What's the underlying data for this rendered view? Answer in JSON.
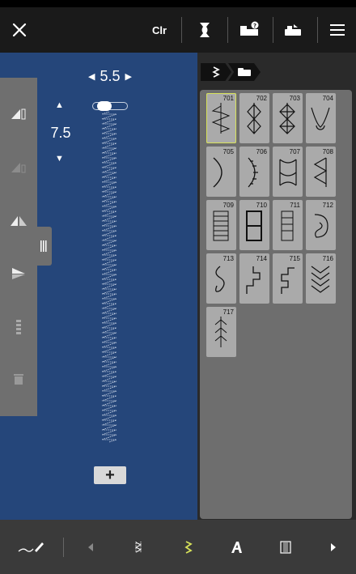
{
  "topbar": {
    "close_icon": "close-icon",
    "clear_label": "Clr",
    "icons": [
      "thread-spool-icon",
      "machine-info-icon",
      "embroidery-mode-icon",
      "menu-icon"
    ]
  },
  "stitch_settings": {
    "width_value": "5.5",
    "length_value": "7.5"
  },
  "side_toolbar": {
    "items": [
      "mirror-horizontal-icon",
      "mirror-vertical-icon",
      "mirror-both-icon",
      "flip-icon",
      "stitch-sequence-icon",
      "delete-icon"
    ]
  },
  "breadcrumb": {
    "items": [
      "stitch-category-icon",
      "folder-icon"
    ]
  },
  "stitches": [
    {
      "number": "701",
      "selected": true
    },
    {
      "number": "702",
      "selected": false
    },
    {
      "number": "703",
      "selected": false
    },
    {
      "number": "704",
      "selected": false
    },
    {
      "number": "705",
      "selected": false
    },
    {
      "number": "706",
      "selected": false
    },
    {
      "number": "707",
      "selected": false
    },
    {
      "number": "708",
      "selected": false
    },
    {
      "number": "709",
      "selected": false
    },
    {
      "number": "710",
      "selected": false
    },
    {
      "number": "711",
      "selected": false
    },
    {
      "number": "712",
      "selected": false
    },
    {
      "number": "713",
      "selected": false
    },
    {
      "number": "714",
      "selected": false
    },
    {
      "number": "715",
      "selected": false
    },
    {
      "number": "716",
      "selected": false
    },
    {
      "number": "717",
      "selected": false
    }
  ],
  "bottombar": {
    "add_label": "+",
    "items": [
      "sewing-mode-icon",
      "scroll-left-icon",
      "practical-stitch-icon",
      "decorative-stitch-icon",
      "alphabet-icon",
      "buttonhole-icon",
      "scroll-right-icon"
    ]
  },
  "colors": {
    "stitch_area_bg": "#25467a",
    "accent_yellow": "#d7e25a",
    "tile_bg": "#aaaaaa"
  }
}
